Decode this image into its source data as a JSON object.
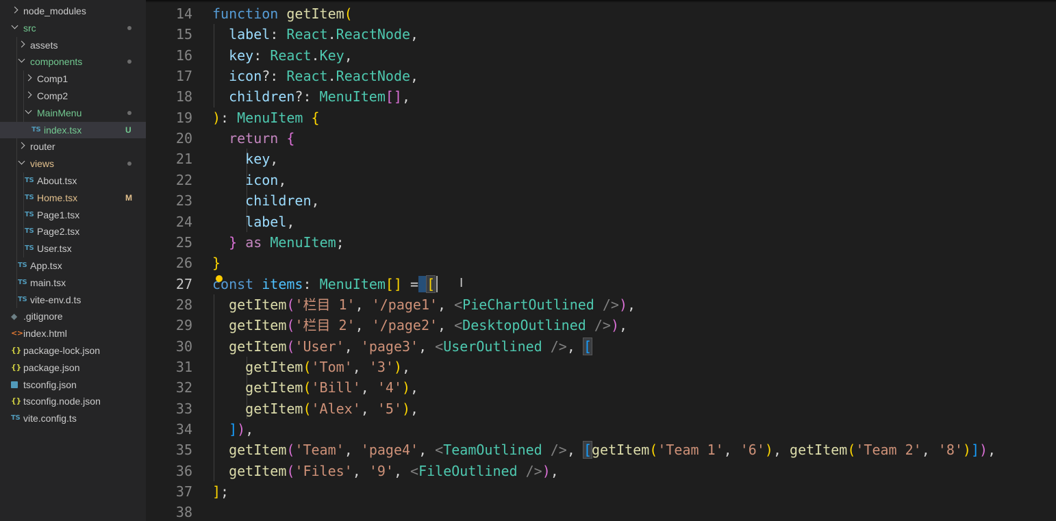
{
  "explorer": {
    "items": [
      {
        "label": "node_modules",
        "kind": "folder",
        "open": false
      },
      {
        "label": "src",
        "kind": "folder",
        "open": true,
        "status": "dot",
        "color": "green"
      },
      {
        "label": "assets",
        "kind": "folder",
        "open": false
      },
      {
        "label": "components",
        "kind": "folder",
        "open": true,
        "status": "dot",
        "color": "green"
      },
      {
        "label": "Comp1",
        "kind": "folder",
        "open": false
      },
      {
        "label": "Comp2",
        "kind": "folder",
        "open": false
      },
      {
        "label": "MainMenu",
        "kind": "folder",
        "open": true,
        "status": "dot",
        "color": "green"
      },
      {
        "label": "index.tsx",
        "kind": "file",
        "icon": "TS",
        "badge": "U",
        "color": "green",
        "active": true
      },
      {
        "label": "router",
        "kind": "folder",
        "open": false
      },
      {
        "label": "views",
        "kind": "folder",
        "open": true,
        "status": "dot",
        "color": "yellow"
      },
      {
        "label": "About.tsx",
        "kind": "file",
        "icon": "TS"
      },
      {
        "label": "Home.tsx",
        "kind": "file",
        "icon": "TS",
        "badge": "M",
        "color": "yellow"
      },
      {
        "label": "Page1.tsx",
        "kind": "file",
        "icon": "TS"
      },
      {
        "label": "Page2.tsx",
        "kind": "file",
        "icon": "TS"
      },
      {
        "label": "User.tsx",
        "kind": "file",
        "icon": "TS"
      },
      {
        "label": "App.tsx",
        "kind": "file",
        "icon": "TS"
      },
      {
        "label": "main.tsx",
        "kind": "file",
        "icon": "TS"
      },
      {
        "label": "vite-env.d.ts",
        "kind": "file",
        "icon": "TS"
      },
      {
        "label": ".gitignore",
        "kind": "file",
        "icon": "git"
      },
      {
        "label": "index.html",
        "kind": "file",
        "icon": "html"
      },
      {
        "label": "package-lock.json",
        "kind": "file",
        "icon": "json"
      },
      {
        "label": "package.json",
        "kind": "file",
        "icon": "json"
      },
      {
        "label": "tsconfig.json",
        "kind": "file",
        "icon": "tsconfig"
      },
      {
        "label": "tsconfig.node.json",
        "kind": "file",
        "icon": "json"
      },
      {
        "label": "vite.config.ts",
        "kind": "file",
        "icon": "TS"
      }
    ],
    "icon_glyphs": {
      "TS": "TS",
      "json": "{}",
      "html": "<>",
      "git": "◆"
    }
  },
  "editor": {
    "current_line": 27,
    "lines": [
      {
        "n": "14",
        "t": [
          [
            "kw",
            "function"
          ],
          [
            "plain",
            " "
          ],
          [
            "fn",
            "getItem"
          ],
          [
            "b1",
            "("
          ]
        ]
      },
      {
        "n": "15",
        "t": [
          [
            "plain",
            "  "
          ],
          [
            "var",
            "label"
          ],
          [
            "plain",
            ": "
          ],
          [
            "ty",
            "React"
          ],
          [
            "plain",
            "."
          ],
          [
            "ty",
            "ReactNode"
          ],
          [
            "plain",
            ","
          ]
        ]
      },
      {
        "n": "16",
        "t": [
          [
            "plain",
            "  "
          ],
          [
            "var",
            "key"
          ],
          [
            "plain",
            ": "
          ],
          [
            "ty",
            "React"
          ],
          [
            "plain",
            "."
          ],
          [
            "ty",
            "Key"
          ],
          [
            "plain",
            ","
          ]
        ]
      },
      {
        "n": "17",
        "t": [
          [
            "plain",
            "  "
          ],
          [
            "var",
            "icon"
          ],
          [
            "plain",
            "?: "
          ],
          [
            "ty",
            "React"
          ],
          [
            "plain",
            "."
          ],
          [
            "ty",
            "ReactNode"
          ],
          [
            "plain",
            ","
          ]
        ]
      },
      {
        "n": "18",
        "t": [
          [
            "plain",
            "  "
          ],
          [
            "var",
            "children"
          ],
          [
            "plain",
            "?: "
          ],
          [
            "ty",
            "MenuItem"
          ],
          [
            "b2",
            "[]"
          ],
          [
            "plain",
            ","
          ]
        ]
      },
      {
        "n": "19",
        "t": [
          [
            "b1",
            ")"
          ],
          [
            "plain",
            ": "
          ],
          [
            "ty",
            "MenuItem"
          ],
          [
            "plain",
            " "
          ],
          [
            "b1",
            "{"
          ]
        ]
      },
      {
        "n": "20",
        "t": [
          [
            "plain",
            "  "
          ],
          [
            "ctl",
            "return"
          ],
          [
            "plain",
            " "
          ],
          [
            "b2",
            "{"
          ]
        ]
      },
      {
        "n": "21",
        "t": [
          [
            "plain",
            "    "
          ],
          [
            "var",
            "key"
          ],
          [
            "plain",
            ","
          ]
        ]
      },
      {
        "n": "22",
        "t": [
          [
            "plain",
            "    "
          ],
          [
            "var",
            "icon"
          ],
          [
            "plain",
            ","
          ]
        ]
      },
      {
        "n": "23",
        "t": [
          [
            "plain",
            "    "
          ],
          [
            "var",
            "children"
          ],
          [
            "plain",
            ","
          ]
        ]
      },
      {
        "n": "24",
        "t": [
          [
            "plain",
            "    "
          ],
          [
            "var",
            "label"
          ],
          [
            "plain",
            ","
          ]
        ]
      },
      {
        "n": "25",
        "t": [
          [
            "plain",
            "  "
          ],
          [
            "b2",
            "}"
          ],
          [
            "plain",
            " "
          ],
          [
            "ctl",
            "as"
          ],
          [
            "plain",
            " "
          ],
          [
            "ty",
            "MenuItem"
          ],
          [
            "plain",
            ";"
          ]
        ]
      },
      {
        "n": "26",
        "t": [
          [
            "b1",
            "}"
          ]
        ]
      },
      {
        "n": "27",
        "t": [
          [
            "kw",
            "const"
          ],
          [
            "plain",
            " "
          ],
          [
            "cst",
            "items"
          ],
          [
            "plain",
            ": "
          ],
          [
            "ty",
            "MenuItem"
          ],
          [
            "b1",
            "[]"
          ],
          [
            "plain",
            " ="
          ],
          [
            "hl",
            " "
          ],
          [
            "b1 hlb",
            "["
          ]
        ]
      },
      {
        "n": "28",
        "t": [
          [
            "plain",
            "  "
          ],
          [
            "fn",
            "getItem"
          ],
          [
            "b2",
            "("
          ],
          [
            "str",
            "'栏目 1'"
          ],
          [
            "plain",
            ", "
          ],
          [
            "str",
            "'/page1'"
          ],
          [
            "plain",
            ", "
          ],
          [
            "tag",
            "<"
          ],
          [
            "jsx",
            "PieChartOutlined"
          ],
          [
            "plain",
            " "
          ],
          [
            "tag",
            "/>"
          ],
          [
            "b2",
            ")"
          ],
          [
            "plain",
            ","
          ]
        ]
      },
      {
        "n": "29",
        "t": [
          [
            "plain",
            "  "
          ],
          [
            "fn",
            "getItem"
          ],
          [
            "b2",
            "("
          ],
          [
            "str",
            "'栏目 2'"
          ],
          [
            "plain",
            ", "
          ],
          [
            "str",
            "'/page2'"
          ],
          [
            "plain",
            ", "
          ],
          [
            "tag",
            "<"
          ],
          [
            "jsx",
            "DesktopOutlined"
          ],
          [
            "plain",
            " "
          ],
          [
            "tag",
            "/>"
          ],
          [
            "b2",
            ")"
          ],
          [
            "plain",
            ","
          ]
        ]
      },
      {
        "n": "30",
        "t": [
          [
            "plain",
            "  "
          ],
          [
            "fn",
            "getItem"
          ],
          [
            "b2",
            "("
          ],
          [
            "str",
            "'User'"
          ],
          [
            "plain",
            ", "
          ],
          [
            "str",
            "'page3'"
          ],
          [
            "plain",
            ", "
          ],
          [
            "tag",
            "<"
          ],
          [
            "jsx",
            "UserOutlined"
          ],
          [
            "plain",
            " "
          ],
          [
            "tag",
            "/>"
          ],
          [
            "plain",
            ","
          ],
          [
            "plain",
            " "
          ],
          [
            "b3 hlb",
            "["
          ]
        ]
      },
      {
        "n": "31",
        "t": [
          [
            "plain",
            "    "
          ],
          [
            "fn",
            "getItem"
          ],
          [
            "b1",
            "("
          ],
          [
            "str",
            "'Tom'"
          ],
          [
            "plain",
            ", "
          ],
          [
            "str",
            "'3'"
          ],
          [
            "b1",
            ")"
          ],
          [
            "plain",
            ","
          ]
        ]
      },
      {
        "n": "32",
        "t": [
          [
            "plain",
            "    "
          ],
          [
            "fn",
            "getItem"
          ],
          [
            "b1",
            "("
          ],
          [
            "str",
            "'Bill'"
          ],
          [
            "plain",
            ", "
          ],
          [
            "str",
            "'4'"
          ],
          [
            "b1",
            ")"
          ],
          [
            "plain",
            ","
          ]
        ]
      },
      {
        "n": "33",
        "t": [
          [
            "plain",
            "    "
          ],
          [
            "fn",
            "getItem"
          ],
          [
            "b1",
            "("
          ],
          [
            "str",
            "'Alex'"
          ],
          [
            "plain",
            ", "
          ],
          [
            "str",
            "'5'"
          ],
          [
            "b1",
            ")"
          ],
          [
            "plain",
            ","
          ]
        ]
      },
      {
        "n": "34",
        "t": [
          [
            "plain",
            "  "
          ],
          [
            "b3",
            "]"
          ],
          [
            "b2",
            ")"
          ],
          [
            "plain",
            ","
          ]
        ]
      },
      {
        "n": "35",
        "t": [
          [
            "plain",
            "  "
          ],
          [
            "fn",
            "getItem"
          ],
          [
            "b2",
            "("
          ],
          [
            "str",
            "'Team'"
          ],
          [
            "plain",
            ", "
          ],
          [
            "str",
            "'page4'"
          ],
          [
            "plain",
            ", "
          ],
          [
            "tag",
            "<"
          ],
          [
            "jsx",
            "TeamOutlined"
          ],
          [
            "plain",
            " "
          ],
          [
            "tag",
            "/>"
          ],
          [
            "plain",
            ","
          ],
          [
            "plain",
            " "
          ],
          [
            "b3 hlb",
            "["
          ],
          [
            "fn",
            "getItem"
          ],
          [
            "b1",
            "("
          ],
          [
            "str",
            "'Team 1'"
          ],
          [
            "plain",
            ", "
          ],
          [
            "str",
            "'6'"
          ],
          [
            "b1",
            ")"
          ],
          [
            "plain",
            ", "
          ],
          [
            "fn",
            "getItem"
          ],
          [
            "b1",
            "("
          ],
          [
            "str",
            "'Team 2'"
          ],
          [
            "plain",
            ", "
          ],
          [
            "str",
            "'8'"
          ],
          [
            "b1",
            ")"
          ],
          [
            "b3",
            "]"
          ],
          [
            "b2",
            ")"
          ],
          [
            "plain",
            ","
          ]
        ]
      },
      {
        "n": "36",
        "t": [
          [
            "plain",
            "  "
          ],
          [
            "fn",
            "getItem"
          ],
          [
            "b2",
            "("
          ],
          [
            "str",
            "'Files'"
          ],
          [
            "plain",
            ", "
          ],
          [
            "str",
            "'9'"
          ],
          [
            "plain",
            ", "
          ],
          [
            "tag",
            "<"
          ],
          [
            "jsx",
            "FileOutlined"
          ],
          [
            "plain",
            " "
          ],
          [
            "tag",
            "/>"
          ],
          [
            "b2",
            ")"
          ],
          [
            "plain",
            ","
          ]
        ]
      },
      {
        "n": "37",
        "t": [
          [
            "b1",
            "]"
          ],
          [
            "plain",
            ";"
          ]
        ]
      },
      {
        "n": "38",
        "t": []
      }
    ]
  }
}
